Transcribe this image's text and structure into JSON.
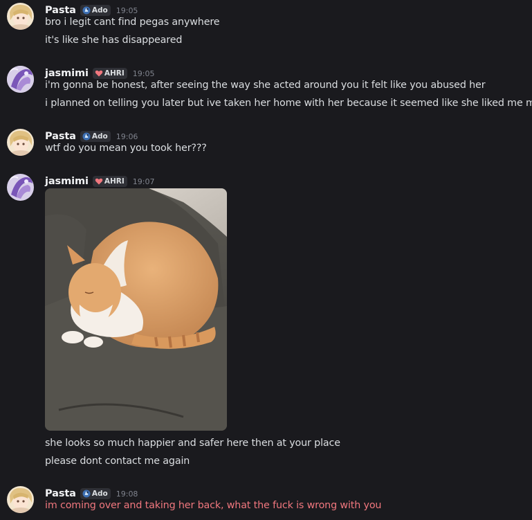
{
  "messages": [
    {
      "author": "Pasta",
      "tag": "Ado",
      "time": "19:05",
      "lines": [
        "bro i legit cant find pegas anywhere",
        "it's like she has disappeared"
      ]
    },
    {
      "author": "jasmimi",
      "tag": "AHRI",
      "time": "19:05",
      "lines": [
        "i'm gonna be honest, after seeing the way she acted around you it felt like you abused her",
        "i planned on telling you later but ive taken her home with her because it seemed like she liked me more"
      ]
    },
    {
      "author": "Pasta",
      "tag": "Ado",
      "time": "19:06",
      "lines": [
        "wtf do you mean you took her???"
      ]
    },
    {
      "author": "jasmimi",
      "tag": "AHRI",
      "time": "19:07",
      "attachment_icon": "cat-photo",
      "lines": [
        "she looks so much happier and safer here then at your place",
        "please dont contact me again"
      ]
    },
    {
      "author": "Pasta",
      "tag": "Ado",
      "time": "19:08",
      "lines": [
        "im coming over and taking her back, what the fuck is wrong with you"
      ]
    }
  ],
  "colors": {
    "background": "#1a1a1e",
    "text": "#dbdee1",
    "danger_text": "#f0777e",
    "timestamp": "#80848e",
    "tag_bg": "#2f3036"
  }
}
